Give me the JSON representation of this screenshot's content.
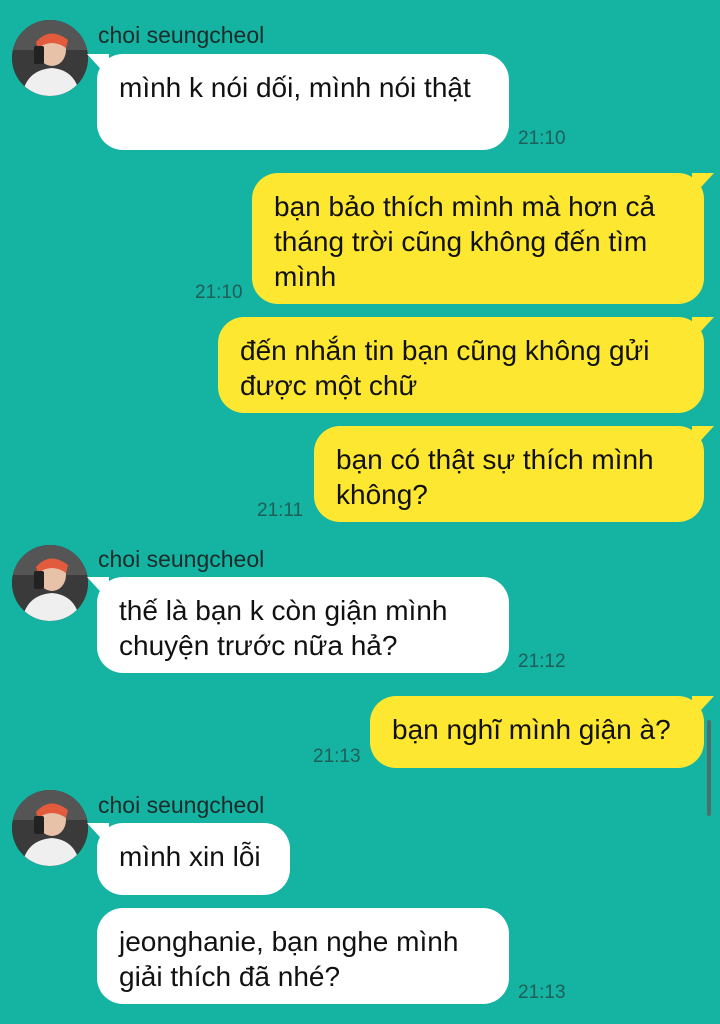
{
  "contact": {
    "name": "choi seungcheol"
  },
  "messages": [
    {
      "from": "them",
      "text": "mình k nói dối, mình nói thật",
      "time": "21:10"
    },
    {
      "from": "me",
      "text": "bạn bảo thích mình mà hơn cả tháng trời cũng không đến tìm mình",
      "time": "21:10"
    },
    {
      "from": "me",
      "text": "đến nhắn tin bạn cũng không gửi được một chữ",
      "time": ""
    },
    {
      "from": "me",
      "text": "bạn có thật sự thích mình không?",
      "time": "21:11"
    },
    {
      "from": "them",
      "text": "thế là bạn k còn giận mình chuyện trước nữa hả?",
      "time": "21:12"
    },
    {
      "from": "me",
      "text": "bạn nghĩ mình giận à?",
      "time": "21:13"
    },
    {
      "from": "them",
      "text": "mình xin lỗi",
      "time": ""
    },
    {
      "from": "them",
      "text": "jeonghanie, bạn nghe mình giải thích đã nhé?",
      "time": "21:13"
    }
  ],
  "colors": {
    "background": "#14b3a2",
    "incoming_bubble": "#ffffff",
    "outgoing_bubble": "#fde730",
    "timestamp": "#1f5f58"
  },
  "icons": {
    "avatar": "profile-photo"
  }
}
